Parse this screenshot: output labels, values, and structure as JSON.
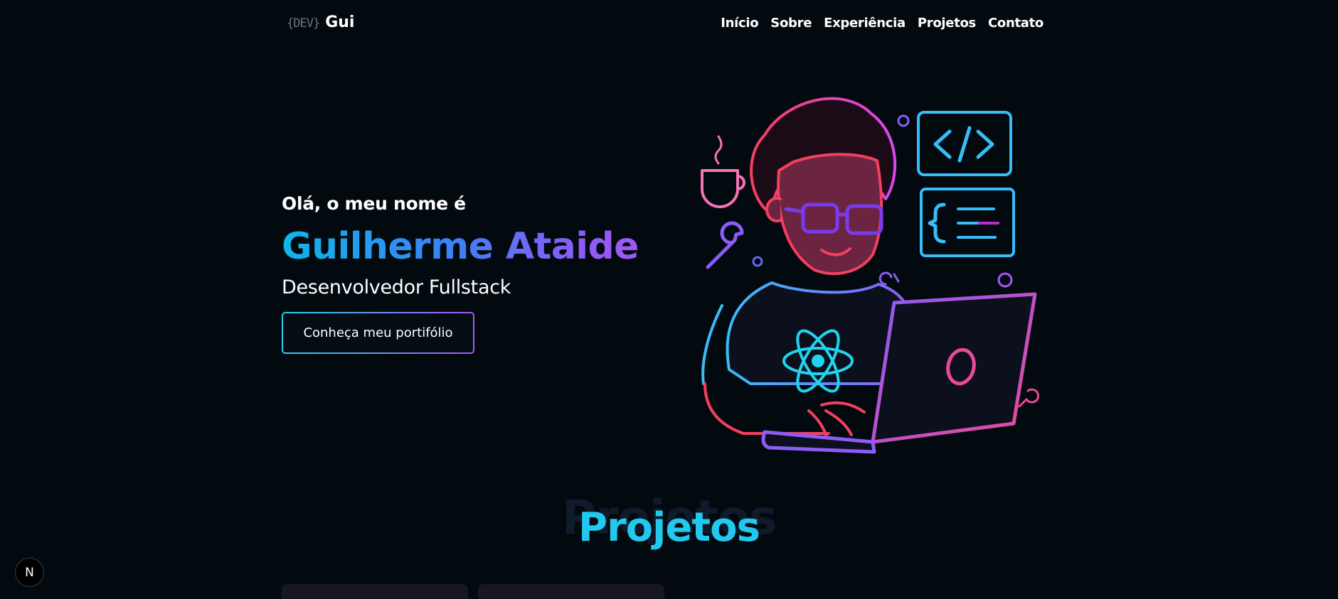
{
  "header": {
    "logo_tag": "{DEV}",
    "logo_name": "Gui",
    "nav": [
      "Início",
      "Sobre",
      "Experiência",
      "Projetos",
      "Contato"
    ]
  },
  "hero": {
    "greeting": "Olá, o meu nome é",
    "name": "Guilherme Ataide",
    "role": "Desenvolvedor Fullstack",
    "cta_label": "Conheça meu portifólio",
    "illustration": "developer-with-laptop-neon-illustration"
  },
  "projects_section": {
    "title_shadow": "Projetos",
    "title": "Projetos"
  },
  "floating_button": {
    "label": "N",
    "icon": "nextjs-logo-icon"
  },
  "colors": {
    "background": "#030a0f",
    "accent_cyan": "#22c8ee",
    "accent_blue": "#3b82f6",
    "accent_purple": "#a855f7",
    "accent_pink": "#ec4899"
  }
}
